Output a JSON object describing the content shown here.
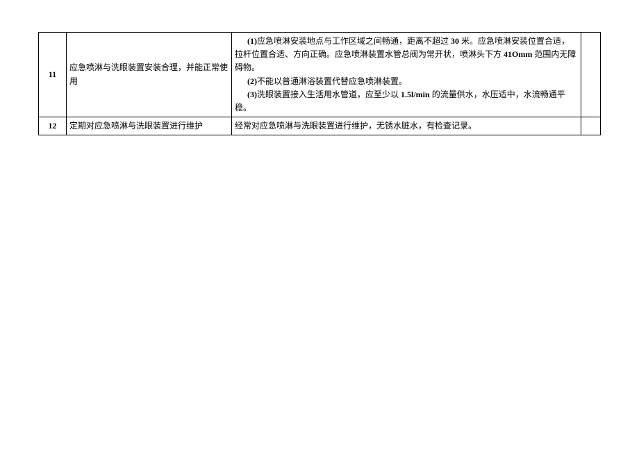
{
  "table": {
    "rows": [
      {
        "num": "11",
        "item": "应急喷淋与洗眼装置安装合理，并能正常使用",
        "desc_line1_label": "(1)",
        "desc_line1_text_a": "应急喷淋安装地点与工作区域之间畅通，距离不超过 ",
        "desc_line1_bold_a": "30",
        "desc_line1_text_b": " 米。应急喷淋安装位置合适，拉杆位置合适、方向正确。应急喷淋装置水管总阀为常开状，喷淋头下方 ",
        "desc_line1_bold_b": "41Omm",
        "desc_line1_text_c": " 范围内无障碍物。",
        "desc_line2_label": "(2)",
        "desc_line2_text": "不能以普通淋浴装置代替应急喷淋装置。",
        "desc_line3_label": "(3)",
        "desc_line3_text_a": "洗眼装置接入生活用水管道，应至少以 ",
        "desc_line3_bold": "1.5l/min",
        "desc_line3_text_b": " 的流量供水，水压适中，水流畅通平稳。"
      },
      {
        "num": "12",
        "item": "定期对应急喷淋与洗眼装置进行维护",
        "desc": "经常对应急喷淋与洗眼装置进行维护，无锈水脏水，有检查记录。"
      }
    ]
  }
}
